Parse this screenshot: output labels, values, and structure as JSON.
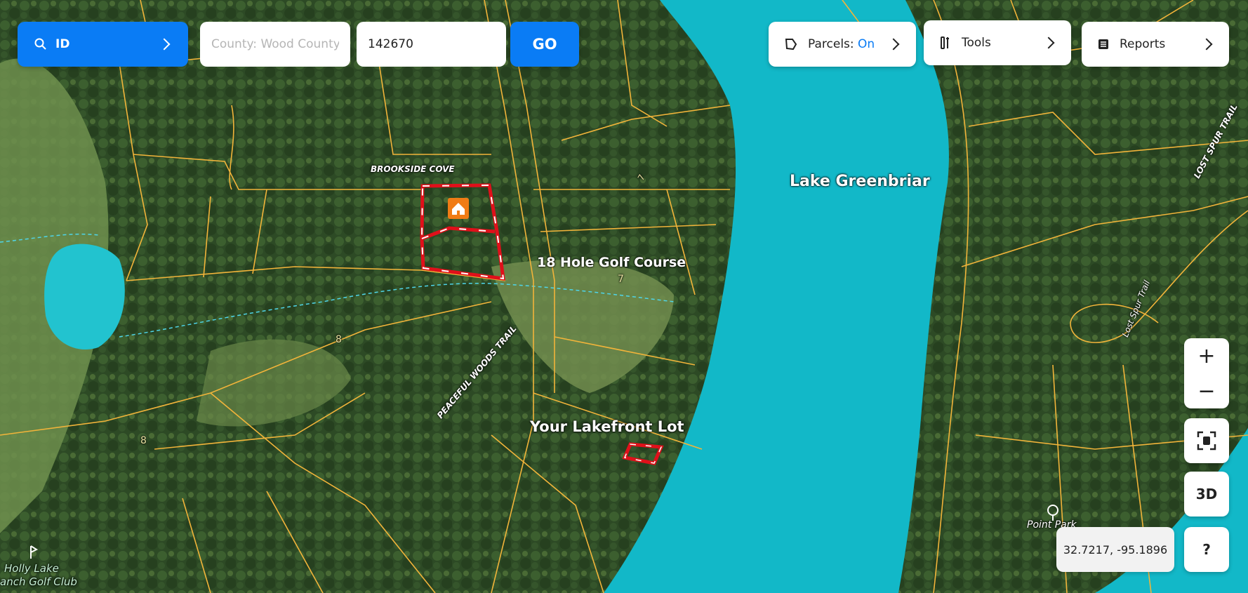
{
  "search": {
    "mode_label": "ID",
    "county_placeholder": "County: Wood County",
    "parcel_value": "142670",
    "go_label": "GO"
  },
  "toolbar": {
    "parcels_label": "Parcels:",
    "parcels_state": "On",
    "tools_label": "Tools",
    "reports_label": "Reports"
  },
  "map": {
    "lake_label": "Lake Greenbriar",
    "golf_label": "18 Hole Golf Course",
    "lot_label": "Your Lakefront Lot",
    "streets": [
      "BROOKSIDE COVE",
      "PEACEFUL WOODS TRAIL",
      "LOST SPUR TRAIL",
      "Lost Spur Trail"
    ],
    "poi_park": "Point Park",
    "poi_club_line1": "Holly Lake",
    "poi_club_line2": "anch Golf Club",
    "hole_numbers": [
      "7",
      "7",
      "8",
      "8"
    ]
  },
  "controls": {
    "zoom_in": "+",
    "zoom_out": "−",
    "btn_3d": "3D",
    "help": "?",
    "coordinates": "32.7217, -95.1896"
  },
  "colors": {
    "accent": "#0a7cf5",
    "water": "#12b8c8",
    "parcel_line": "#f2b43a",
    "selected_parcel": "#e0101a"
  }
}
